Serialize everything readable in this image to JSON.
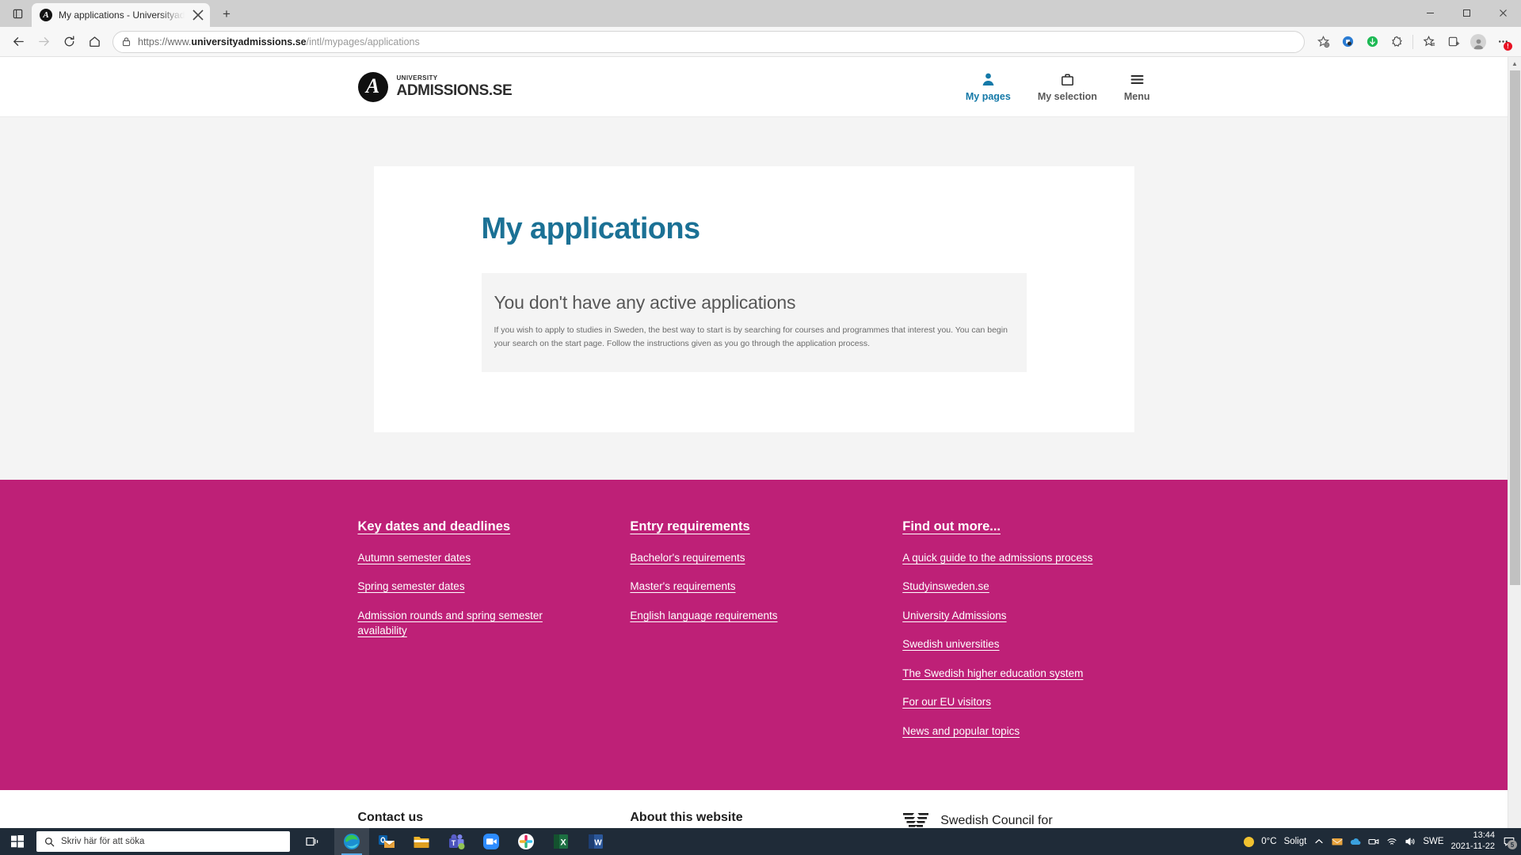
{
  "browser": {
    "tab": {
      "title": "My applications - Universityadm",
      "favicon_letter": "A",
      "favicon_name": "university-admissions-favicon",
      "close_label": "×"
    },
    "newtab_label": "+",
    "window_controls": {
      "minimize": "minimize",
      "maximize": "maximize",
      "close": "close"
    },
    "nav": {
      "back": "back",
      "forward": "forward",
      "refresh": "refresh",
      "home": "home"
    },
    "omnibox": {
      "scheme": "https://www.",
      "domain": "universityadmissions.se",
      "path": "/intl/mypages/applications",
      "full_url": "https://www.universityadmissions.se/intl/mypages/applications",
      "lock_icon": "lock-icon"
    },
    "toolbar_icons": [
      "split-screen-icon",
      "shopping-icon",
      "collections-sync-icon",
      "settings-gear-icon",
      "favorites-star-icon",
      "collections-icon",
      "profile-avatar",
      "more-options-icon"
    ],
    "more_badge": "!"
  },
  "site_header": {
    "logo": {
      "mark_letter": "A",
      "top_line": "UNIVERSITY",
      "main_line": "ADMISSIONS.SE"
    },
    "nav": [
      {
        "icon": "person-icon",
        "label": "My pages",
        "active": true
      },
      {
        "icon": "briefcase-icon",
        "label": "My selection",
        "active": false
      },
      {
        "icon": "hamburger-menu-icon",
        "label": "Menu",
        "active": false
      }
    ],
    "active_color": "#1479a8"
  },
  "main": {
    "page_title": "My applications",
    "title_color": "#1b7195",
    "info_box": {
      "heading": "You don't have any active applications",
      "body": "If you wish to apply to studies in Sweden, the best way to start is by searching for courses and programmes that interest you. You can begin your search on the start page. Follow the instructions given as you go through the application process."
    }
  },
  "footer": {
    "background_color": "#be2077",
    "columns": [
      {
        "heading": "Key dates and deadlines",
        "links": [
          "Autumn semester dates",
          "Spring semester dates",
          "Admission rounds and spring semester availability"
        ]
      },
      {
        "heading": "Entry requirements",
        "links": [
          "Bachelor's requirements",
          "Master's requirements",
          "English language requirements"
        ]
      },
      {
        "heading": "Find out more...",
        "links": [
          "A quick guide to the admissions process",
          "Studyinsweden.se",
          "University Admissions",
          "Swedish universities",
          "The Swedish higher education system",
          "For our EU visitors",
          "News and popular topics"
        ]
      }
    ]
  },
  "footer_bottom": {
    "contact": "Contact us",
    "about": "About this website",
    "council_logo": "swedish-council-wings-logo",
    "council_text": "Swedish Council for"
  },
  "taskbar": {
    "start_icon": "windows-start-icon",
    "search_placeholder": "Skriv här för att söka",
    "search_icon": "search-icon",
    "taskview_icon": "task-view-icon",
    "apps": [
      {
        "name": "microsoft-edge",
        "glyph": "e",
        "color": "#1b8fd1",
        "active": true
      },
      {
        "name": "outlook",
        "glyph": "O",
        "color": "#0a5fa8",
        "active": false
      },
      {
        "name": "file-explorer",
        "glyph": "▬",
        "color": "#f0b429",
        "active": false
      },
      {
        "name": "microsoft-teams",
        "glyph": "T",
        "color": "#5b5fc7",
        "active": false
      },
      {
        "name": "zoom",
        "glyph": "■",
        "color": "#2d8cff",
        "active": false
      },
      {
        "name": "slack",
        "glyph": "#",
        "color": "#e01e5a",
        "active": false
      },
      {
        "name": "excel",
        "glyph": "X",
        "color": "#1d6f42",
        "active": false
      },
      {
        "name": "word",
        "glyph": "W",
        "color": "#2b579a",
        "active": false
      }
    ],
    "tray": {
      "weather_icon": "sun-icon",
      "temperature": "0°C",
      "weather_text": "Soligt",
      "chevron": "show-hidden-icons",
      "icons": [
        "mail-icon",
        "onedrive-icon",
        "devices-icon",
        "wifi-icon",
        "volume-icon"
      ],
      "language": "SWE",
      "time": "13:44",
      "date": "2021-11-22",
      "notification_icon": "notifications-icon",
      "notification_count": "5"
    }
  }
}
